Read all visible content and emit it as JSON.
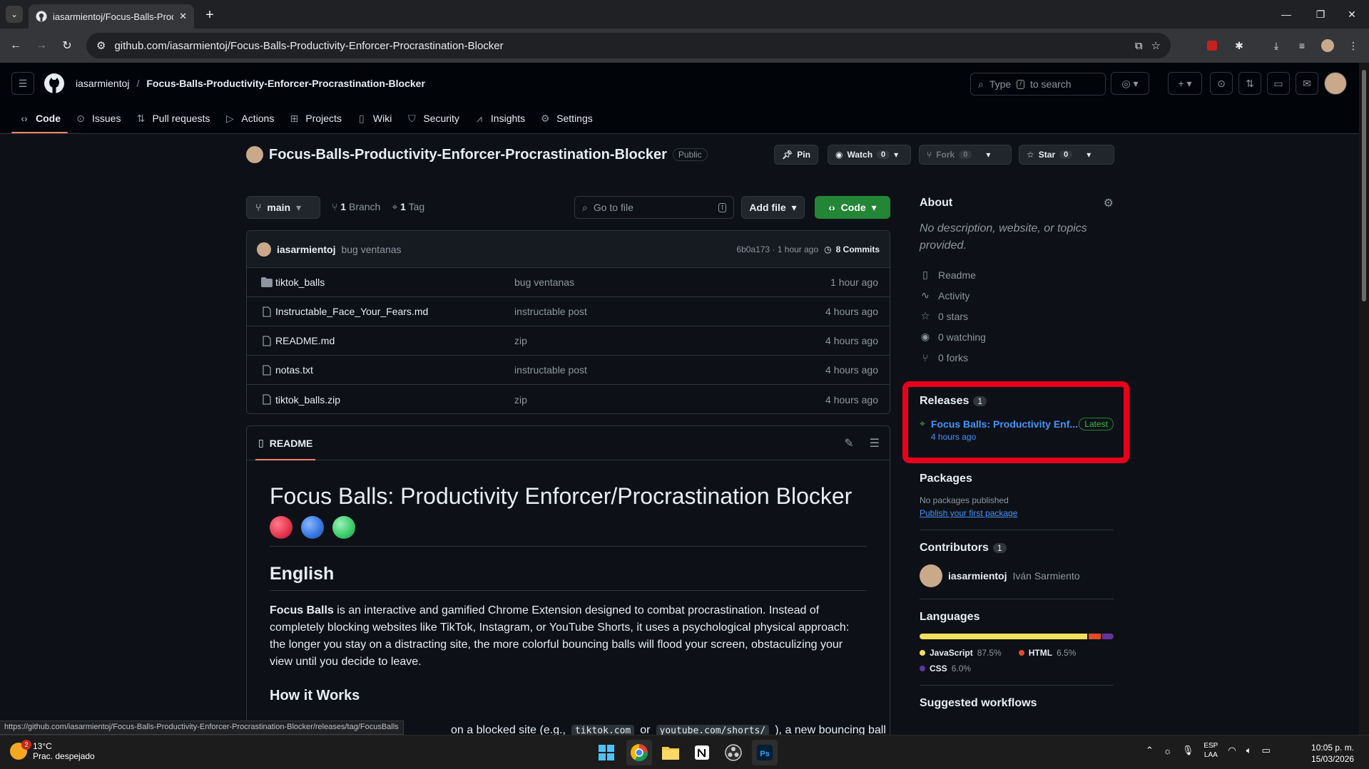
{
  "browser": {
    "tab_title": "iasarmientoj/Focus-Balls-Produ",
    "url": "github.com/iasarmientoj/Focus-Balls-Productivity-Enforcer-Procrastination-Blocker",
    "status_url": "https://github.com/iasarmientoj/Focus-Balls-Productivity-Enforcer-Procrastination-Blocker/releases/tag/FocusBalls"
  },
  "header": {
    "owner": "iasarmientoj",
    "separator": "/",
    "repo": "Focus-Balls-Productivity-Enforcer-Procrastination-Blocker",
    "search_pre": "Type",
    "search_key": "/",
    "search_post": "to search"
  },
  "repo_nav": {
    "code": "Code",
    "issues": "Issues",
    "pulls": "Pull requests",
    "actions": "Actions",
    "projects": "Projects",
    "wiki": "Wiki",
    "security": "Security",
    "insights": "Insights",
    "settings": "Settings"
  },
  "repo": {
    "title": "Focus-Balls-Productivity-Enforcer-Procrastination-Blocker",
    "visibility": "Public",
    "pin": "Pin",
    "watch": "Watch",
    "watch_count": "0",
    "fork": "Fork",
    "fork_count": "0",
    "star": "Star",
    "star_count": "0"
  },
  "branch": {
    "name": "main",
    "branch_count": "1",
    "branch_label": "Branch",
    "tag_count": "1",
    "tag_label": "Tag",
    "goto_placeholder": "Go to file",
    "goto_key": "t",
    "add_file": "Add file",
    "code": "Code"
  },
  "commit": {
    "author": "iasarmientoj",
    "message": "bug ventanas",
    "sha_time": "6b0a173 · 1 hour ago",
    "commits": "8 Commits"
  },
  "files": [
    {
      "name": "tiktok_balls",
      "message": "bug ventanas",
      "time": "1 hour ago",
      "type": "folder"
    },
    {
      "name": "Instructable_Face_Your_Fears.md",
      "message": "instructable post",
      "time": "4 hours ago",
      "type": "file"
    },
    {
      "name": "README.md",
      "message": "zip",
      "time": "4 hours ago",
      "type": "file"
    },
    {
      "name": "notas.txt",
      "message": "instructable post",
      "time": "4 hours ago",
      "type": "file"
    },
    {
      "name": "tiktok_balls.zip",
      "message": "zip",
      "time": "4 hours ago",
      "type": "file"
    }
  ],
  "readme": {
    "tab": "README",
    "h1": "Focus Balls: Productivity Enforcer/Procrastination Blocker",
    "h2": "English",
    "p_bold": "Focus Balls",
    "p_rest": " is an interactive and gamified Chrome Extension designed to combat procrastination. Instead of completely blocking websites like TikTok, Instagram, or YouTube Shorts, it uses a psychological physical approach: the longer you stay on a distracting site, the more colorful bouncing balls will flood your screen, obstaculizing your view until you decide to leave.",
    "h3": "How it Works",
    "line_pre": "on a blocked site (e.g.,",
    "code1": "tiktok.com",
    "line_or": "or",
    "code2": "youtube.com/shorts/",
    "line_post": "), a new bouncing ball",
    "ball_colors": [
      "#e63950",
      "#3b7be0",
      "#3fcf6e"
    ]
  },
  "sidebar": {
    "about": "About",
    "description": "No description, website, or topics provided.",
    "readme": "Readme",
    "activity": "Activity",
    "stars": "0 stars",
    "watching": "0 watching",
    "forks": "0 forks",
    "releases": "Releases",
    "releases_count": "1",
    "release_name": "Focus Balls: Productivity Enf...",
    "release_badge": "Latest",
    "release_time": "4 hours ago",
    "packages": "Packages",
    "no_packages": "No packages published",
    "publish_link": "Publish your first package",
    "contributors": "Contributors",
    "contributors_count": "1",
    "contributor_login": "iasarmientoj",
    "contributor_name": "Iván Sarmiento",
    "languages": "Languages",
    "lang": [
      {
        "name": "JavaScript",
        "pct": "87.5%",
        "value": 87.5,
        "color": "#f1e05a"
      },
      {
        "name": "HTML",
        "pct": "6.5%",
        "value": 6.5,
        "color": "#e34c26"
      },
      {
        "name": "CSS",
        "pct": "6.0%",
        "value": 6.0,
        "color": "#663399"
      }
    ],
    "suggested": "Suggested workflows"
  },
  "taskbar": {
    "temp": "13°C",
    "weather": "Prac. despejado",
    "notif": "2",
    "lang_top": "ESP",
    "lang_bottom": "LAA",
    "time": "10:05 p. m.",
    "date": "15/03/2026"
  }
}
